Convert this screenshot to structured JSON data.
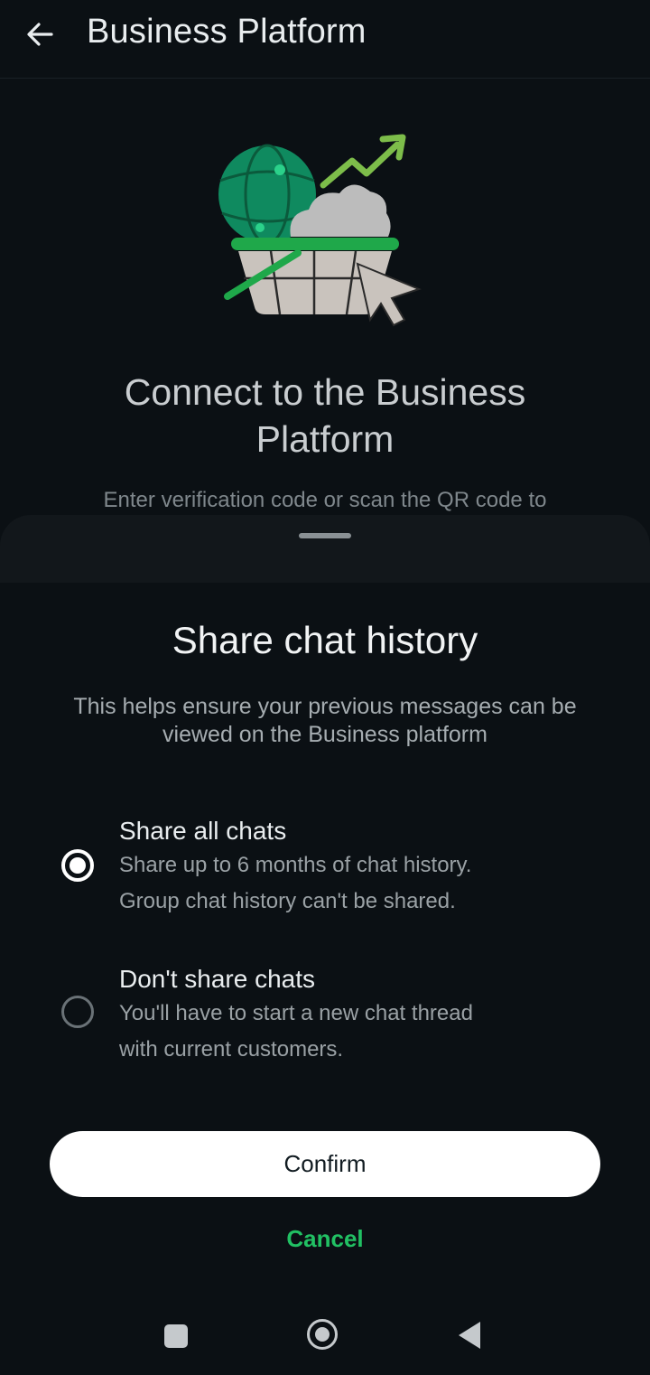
{
  "appbar": {
    "title": "Business Platform",
    "back_icon": "arrow-left-icon"
  },
  "background": {
    "illustration_icon": "business-platform-illustration",
    "headline": "Connect to the Business Platform",
    "subline": "Enter verification code or scan the QR code to"
  },
  "sheet": {
    "title": "Share chat history",
    "description": "This helps ensure your previous messages can be viewed on the Business platform",
    "options": [
      {
        "title": "Share all chats",
        "desc_line1": "Share up to 6 months of chat history.",
        "desc_line2": "Group chat history can't be shared.",
        "selected": true
      },
      {
        "title": "Don't share chats",
        "desc_line1": "You'll have to start a new chat thread",
        "desc_line2": "with current customers.",
        "selected": false
      }
    ],
    "confirm_label": "Confirm",
    "cancel_label": "Cancel"
  },
  "navbar": {
    "recents_icon": "square-icon",
    "home_icon": "home-circle-icon",
    "back_icon": "triangle-back-icon"
  },
  "colors": {
    "background": "#0b1014",
    "accent_green": "#21c063",
    "button_bg": "#ffffff"
  }
}
